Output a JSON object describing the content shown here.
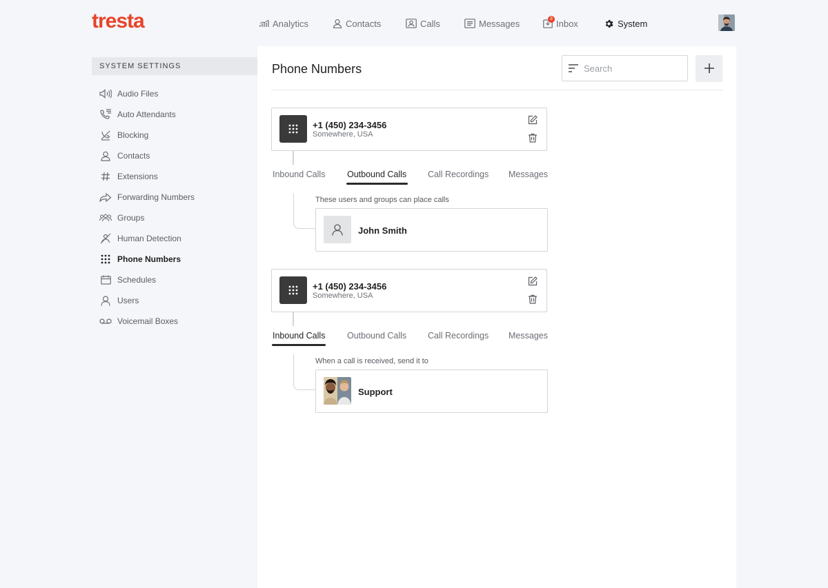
{
  "brand": {
    "logo": "tresta",
    "accent": "#e8432a"
  },
  "nav": {
    "items": [
      {
        "label": "Analytics",
        "icon": "chart-icon"
      },
      {
        "label": "Contacts",
        "icon": "person-icon"
      },
      {
        "label": "Calls",
        "icon": "contact-card-icon"
      },
      {
        "label": "Messages",
        "icon": "message-icon"
      },
      {
        "label": "Inbox",
        "icon": "inbox-icon",
        "badge": "3"
      },
      {
        "label": "System",
        "icon": "gear-icon",
        "active": true
      }
    ]
  },
  "sidebar": {
    "header": "SYSTEM SETTINGS",
    "items": [
      {
        "label": "Audio Files",
        "icon": "speaker-icon"
      },
      {
        "label": "Auto Attendants",
        "icon": "phone-menu-icon"
      },
      {
        "label": "Blocking",
        "icon": "blocked-icon"
      },
      {
        "label": "Contacts",
        "icon": "person-icon"
      },
      {
        "label": "Extensions",
        "icon": "hash-icon"
      },
      {
        "label": "Forwarding Numbers",
        "icon": "forward-arrow-icon"
      },
      {
        "label": "Groups",
        "icon": "group-icon"
      },
      {
        "label": "Human Detection",
        "icon": "human-detection-icon"
      },
      {
        "label": "Phone Numbers",
        "icon": "keypad-icon",
        "active": true
      },
      {
        "label": "Schedules",
        "icon": "calendar-icon"
      },
      {
        "label": "Users",
        "icon": "user-icon"
      },
      {
        "label": "Voicemail Boxes",
        "icon": "voicemail-icon"
      }
    ]
  },
  "main": {
    "title": "Phone Numbers",
    "search": {
      "placeholder": "Search",
      "value": ""
    },
    "add_label": "+",
    "numbers": [
      {
        "number": "+1 (450) 234-3456",
        "location": "Somewhere, USA",
        "tabs": [
          "Inbound Calls",
          "Outbound Calls",
          "Call Recordings",
          "Messages"
        ],
        "active_tab": "Outbound Calls",
        "description": "These users and groups can place calls",
        "target": {
          "name": "John Smith",
          "type": "user"
        }
      },
      {
        "number": "+1 (450) 234-3456",
        "location": "Somewhere, USA",
        "tabs": [
          "Inbound Calls",
          "Outbound Calls",
          "Call Recordings",
          "Messages"
        ],
        "active_tab": "Inbound Calls",
        "description": "When a call is received, send it to",
        "target": {
          "name": "Support",
          "type": "group"
        }
      }
    ]
  }
}
